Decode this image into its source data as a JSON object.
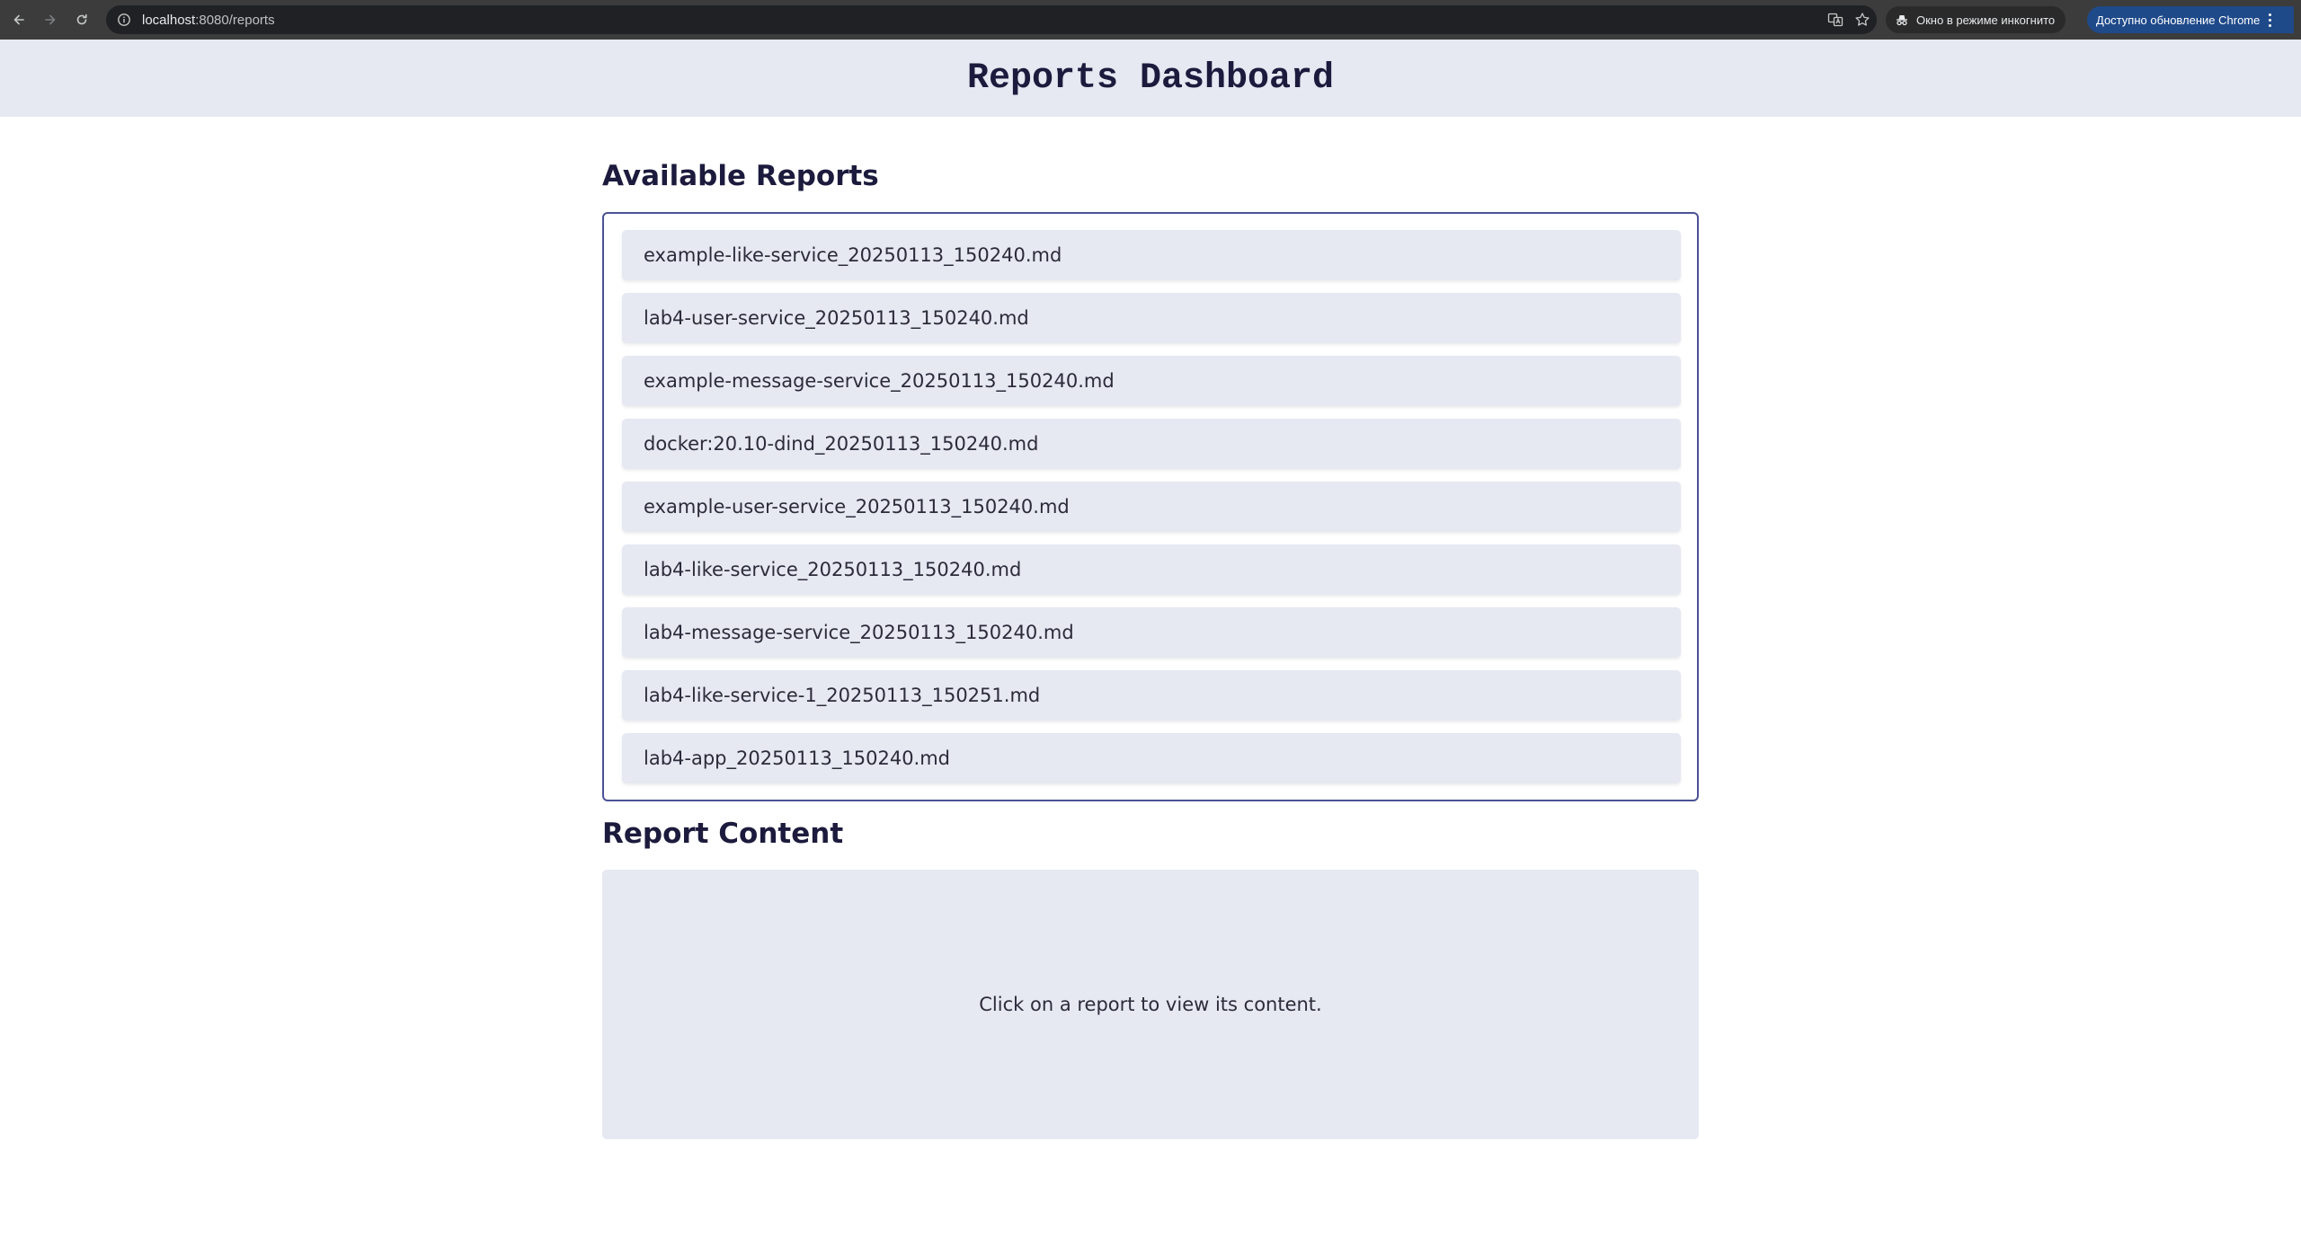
{
  "browser": {
    "url_host": "localhost",
    "url_rest": ":8080/reports",
    "incognito_label": "Окно в режиме инкогнито",
    "update_label": "Доступно обновление Chrome",
    "icons": [
      "back-arrow-icon",
      "forward-arrow-icon",
      "reload-icon",
      "info-icon",
      "translate-icon",
      "star-icon",
      "incognito-icon",
      "more-vert-icon"
    ]
  },
  "header": {
    "title": "Reports Dashboard"
  },
  "reports": {
    "heading": "Available Reports",
    "items": [
      "example-like-service_20250113_150240.md",
      "lab4-user-service_20250113_150240.md",
      "example-message-service_20250113_150240.md",
      "docker:20.10-dind_20250113_150240.md",
      "example-user-service_20250113_150240.md",
      "lab4-like-service_20250113_150240.md",
      "lab4-message-service_20250113_150240.md",
      "lab4-like-service-1_20250113_150251.md",
      "lab4-app_20250113_150240.md"
    ]
  },
  "content": {
    "heading": "Report Content",
    "placeholder": "Click on a report to view its content."
  },
  "colors": {
    "chrome_bar": "#3c3c3c",
    "header_bg": "#e6e8f2",
    "title_text": "#1c1b3d",
    "box_border": "#4a5296",
    "item_bg": "#e6e8f2",
    "update_chip": "#1f4a8a"
  }
}
